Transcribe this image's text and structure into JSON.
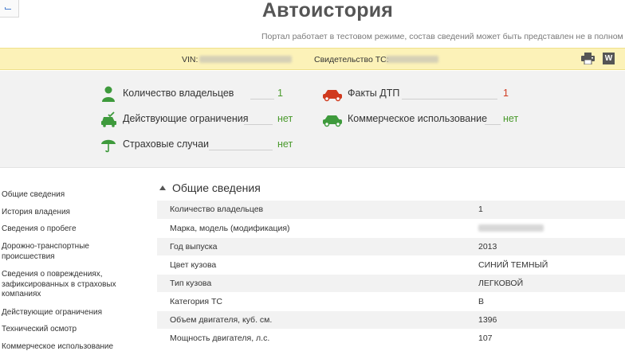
{
  "header": {
    "title": "Автоистория",
    "subtitle": "Портал работает в тестовом режиме, состав сведений может быть представлен не в полном объе"
  },
  "vin_bar": {
    "vin_label": "VIN:",
    "cert_label": "Свидетельство ТС:"
  },
  "summary": {
    "owners": {
      "label": "Количество владельцев",
      "value": "1"
    },
    "restrictions": {
      "label": "Действующие ограничения",
      "value": "нет"
    },
    "insurance": {
      "label": "Страховые случаи",
      "value": "нет"
    },
    "accidents": {
      "label": "Факты ДТП",
      "value": "1"
    },
    "commercial": {
      "label": "Коммерческое использование",
      "value": "нет"
    }
  },
  "sidebar": {
    "items": [
      "Общие сведения",
      "История владения",
      "Сведения о пробеге",
      "Дорожно-транспортные происшествия",
      "Сведения о повреждениях, зафиксированных в страховых компаниях",
      "Действующие ограничения",
      "Технический осмотр",
      "Коммерческое использование"
    ]
  },
  "section": {
    "title": "Общие сведения",
    "rows": [
      {
        "key": "Количество владельцев",
        "value": "1"
      },
      {
        "key": "Марка, модель (модификация)",
        "value": ""
      },
      {
        "key": "Год выпуска",
        "value": "2013"
      },
      {
        "key": "Цвет кузова",
        "value": "СИНИЙ ТЕМНЫЙ"
      },
      {
        "key": "Тип кузова",
        "value": "ЛЕГКОВОЙ"
      },
      {
        "key": "Категория ТС",
        "value": "B"
      },
      {
        "key": "Объем двигателя, куб. см.",
        "value": "1396"
      },
      {
        "key": "Мощность двигателя, л.с.",
        "value": "107"
      }
    ]
  },
  "colors": {
    "accent_green": "#4a9a2c",
    "accent_red": "#d03a1e",
    "vin_bar_bg": "#fcf2b8",
    "summary_bg": "#f2f2f2"
  },
  "icons": [
    "person-icon",
    "car-check-icon",
    "umbrella-icon",
    "red-car-icon",
    "green-car-icon",
    "print-icon",
    "word-icon"
  ]
}
